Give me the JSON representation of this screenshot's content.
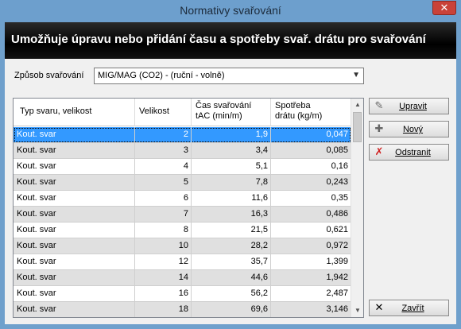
{
  "window": {
    "title": "Normativy svařování",
    "close_symbol": "✕"
  },
  "header": {
    "text": "Umožňuje úpravu nebo přidání času a spotřeby svař. drátu pro svařování"
  },
  "mode": {
    "label": "Způsob svařování",
    "selected": "MIG/MAG (CO2) - (ruční - volně)"
  },
  "grid": {
    "columns": [
      {
        "line1": "Typ svaru, velikost",
        "line2": ""
      },
      {
        "line1": "Velikost",
        "line2": ""
      },
      {
        "line1": "Čas svařování",
        "line2": "tAC (min/m)"
      },
      {
        "line1": "Spotřeba",
        "line2": "drátu (kg/m)"
      }
    ],
    "rows": [
      {
        "type": "Kout. svar",
        "size": "2",
        "time": "1,9",
        "wire": "0,047"
      },
      {
        "type": "Kout. svar",
        "size": "3",
        "time": "3,4",
        "wire": "0,085"
      },
      {
        "type": "Kout. svar",
        "size": "4",
        "time": "5,1",
        "wire": "0,16"
      },
      {
        "type": "Kout. svar",
        "size": "5",
        "time": "7,8",
        "wire": "0,243"
      },
      {
        "type": "Kout. svar",
        "size": "6",
        "time": "11,6",
        "wire": "0,35"
      },
      {
        "type": "Kout. svar",
        "size": "7",
        "time": "16,3",
        "wire": "0,486"
      },
      {
        "type": "Kout. svar",
        "size": "8",
        "time": "21,5",
        "wire": "0,621"
      },
      {
        "type": "Kout. svar",
        "size": "10",
        "time": "28,2",
        "wire": "0,972"
      },
      {
        "type": "Kout. svar",
        "size": "12",
        "time": "35,7",
        "wire": "1,399"
      },
      {
        "type": "Kout. svar",
        "size": "14",
        "time": "44,6",
        "wire": "1,942"
      },
      {
        "type": "Kout. svar",
        "size": "16",
        "time": "56,2",
        "wire": "2,487"
      },
      {
        "type": "Kout. svar",
        "size": "18",
        "time": "69,6",
        "wire": "3,146"
      }
    ],
    "selected_row": 0
  },
  "buttons": {
    "edit": "Upravit",
    "new": "Nový",
    "delete": "Odstranit",
    "close": "Zavřít"
  },
  "icons": {
    "edit": "pencil-icon",
    "new": "plus-icon",
    "delete": "red-x-icon",
    "close": "black-x-icon"
  },
  "colors": {
    "selection": "#3399ff",
    "header_band": "#000000",
    "title_bar": "#6d9fcd",
    "close_button": "#c94239"
  }
}
